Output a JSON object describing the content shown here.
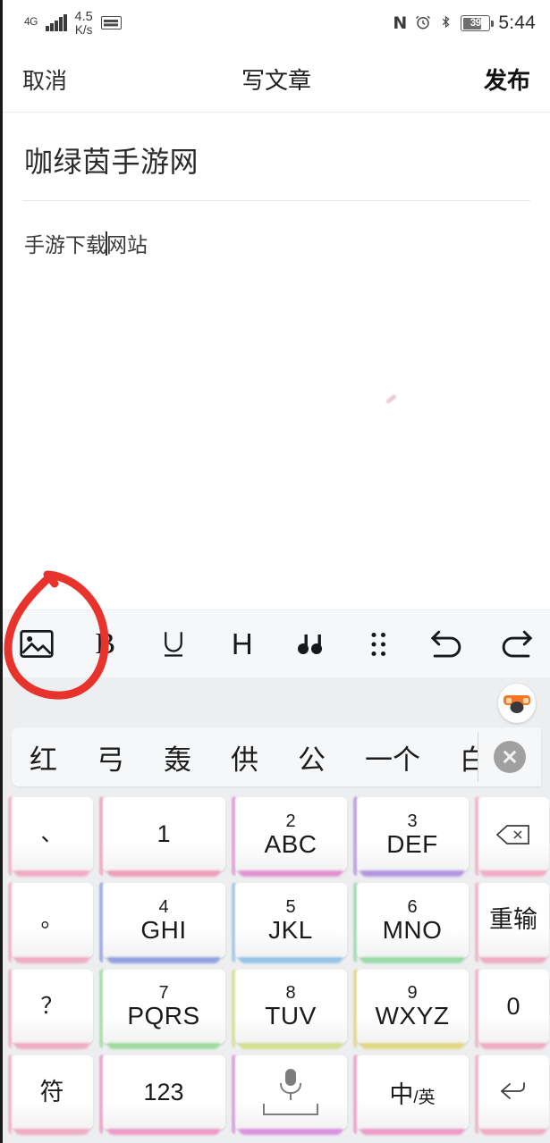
{
  "statusbar": {
    "network_type": "4G",
    "speed_value": "4.5",
    "speed_unit": "K/s",
    "keyboard_icon": "keyboard-icon",
    "nfc_icon": "N",
    "alarm_icon": "⏰",
    "bluetooth_icon": "✻",
    "battery_percent": "39",
    "time": "5:44"
  },
  "navbar": {
    "cancel_label": "取消",
    "title": "写文章",
    "publish_label": "发布"
  },
  "editor": {
    "title_value": "咖绿茵手游网",
    "body_before_caret": "手游下载",
    "body_after_caret": "网站"
  },
  "format_toolbar": {
    "items": [
      {
        "name": "insert-image-button",
        "label": "image"
      },
      {
        "name": "bold-button",
        "label": "B"
      },
      {
        "name": "underline-button",
        "label": "U"
      },
      {
        "name": "heading-button",
        "label": "H"
      },
      {
        "name": "quote-button",
        "label": "❝"
      },
      {
        "name": "list-button",
        "label": "list"
      },
      {
        "name": "undo-button",
        "label": "undo"
      },
      {
        "name": "redo-button",
        "label": "redo"
      }
    ]
  },
  "annotation": {
    "shape": "hand-drawn-ellipse",
    "color": "#e8322c",
    "target": "insert-image-button"
  },
  "ime": {
    "mascot_label": "ime-logo",
    "candidates": [
      "红",
      "弓",
      "轰",
      "供",
      "公",
      "一个",
      "白"
    ],
    "close_label": "✕",
    "keys": [
      {
        "name": "key-dun-comma",
        "main": "、",
        "sub": "",
        "type": "punct",
        "glow": "#f3a9c2"
      },
      {
        "name": "key-1",
        "main": "1",
        "sub": "",
        "type": "single",
        "glow": "#f29ab8"
      },
      {
        "name": "key-2",
        "main": "ABC",
        "sub": "2",
        "type": "alpha",
        "glow": "#e48fd0"
      },
      {
        "name": "key-3",
        "main": "DEF",
        "sub": "3",
        "type": "alpha",
        "glow": "#b292e0"
      },
      {
        "name": "key-backspace",
        "main": "⌫",
        "sub": "",
        "type": "icon",
        "glow": "#f3a9c2"
      },
      {
        "name": "key-period",
        "main": "。",
        "sub": "",
        "type": "punct",
        "glow": "#f3a9c2"
      },
      {
        "name": "key-4",
        "main": "GHI",
        "sub": "4",
        "type": "alpha",
        "glow": "#8f9ee0"
      },
      {
        "name": "key-5",
        "main": "JKL",
        "sub": "5",
        "type": "alpha",
        "glow": "#93c3e8"
      },
      {
        "name": "key-6",
        "main": "MNO",
        "sub": "6",
        "type": "alpha",
        "glow": "#95dba6"
      },
      {
        "name": "key-reinput",
        "main": "重输",
        "sub": "",
        "type": "cjk",
        "glow": "#f3a9c2"
      },
      {
        "name": "key-question-mark",
        "main": "？",
        "sub": "",
        "type": "punct",
        "glow": "#f3a9c2"
      },
      {
        "name": "key-7",
        "main": "PQRS",
        "sub": "7",
        "type": "alpha",
        "glow": "#9ddb9a"
      },
      {
        "name": "key-8",
        "main": "TUV",
        "sub": "8",
        "type": "alpha",
        "glow": "#d3e08a"
      },
      {
        "name": "key-9",
        "main": "WXYZ",
        "sub": "9",
        "type": "alpha",
        "glow": "#e3d77e"
      },
      {
        "name": "key-0",
        "main": "0",
        "sub": "",
        "type": "single",
        "glow": "#f3a9c2"
      },
      {
        "name": "key-symbols",
        "main": "符",
        "sub": "",
        "type": "cjk",
        "glow": "#f3a9c2"
      },
      {
        "name": "key-123",
        "main": "123",
        "sub": "",
        "type": "single",
        "glow": "#ef96c6"
      },
      {
        "name": "key-space",
        "main": "space",
        "sub": "",
        "type": "space",
        "glow": "#d98fe0"
      },
      {
        "name": "key-lang-toggle",
        "main": "中/英",
        "sub": "",
        "type": "lang",
        "glow": "#ef96c6"
      },
      {
        "name": "key-enter",
        "main": "⏎",
        "sub": "",
        "type": "icon",
        "glow": "#f3a9c2"
      }
    ],
    "lang_primary": "中",
    "lang_secondary": "/英"
  }
}
